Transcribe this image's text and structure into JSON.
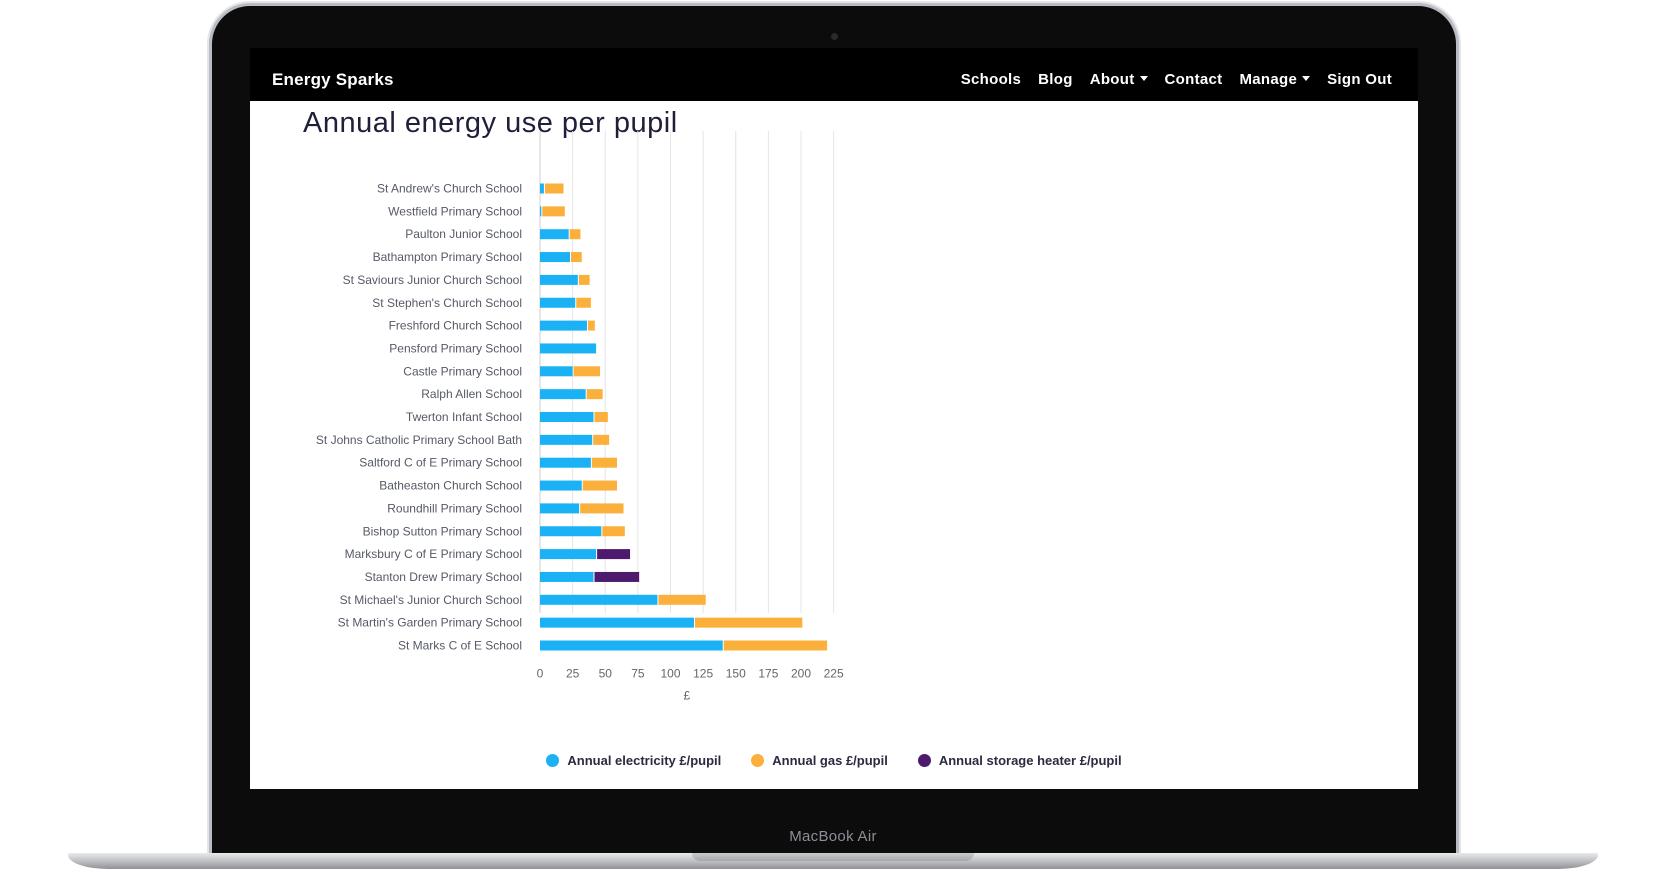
{
  "device_label": "MacBook Air",
  "navbar": {
    "brand": "Energy Sparks",
    "links": [
      "Schools",
      "Blog",
      "About",
      "Contact",
      "Manage",
      "Sign Out"
    ]
  },
  "page_title": "Annual energy use per pupil",
  "colors": {
    "electricity": "#1ab2f5",
    "gas": "#fbb03b",
    "storage_heater": "#4d1a6e",
    "gridline": "#e4e4e4"
  },
  "chart_data": {
    "type": "bar",
    "orientation": "horizontal",
    "stacked": true,
    "categories": [
      "St Andrew's Church School",
      "Westfield Primary School",
      "Paulton Junior School",
      "Bathampton Primary School",
      "St Saviours Junior Church School",
      "St Stephen's Church School",
      "Freshford Church School",
      "Pensford Primary School",
      "Castle Primary School",
      "Ralph Allen School",
      "Twerton Infant School",
      "St Johns Catholic Primary School Bath",
      "Saltford C of E Primary School",
      "Batheaston Church School",
      "Roundhill Primary School",
      "Bishop Sutton Primary School",
      "Marksbury C of E Primary School",
      "Stanton Drew Primary School",
      "St Michael's Junior Church School",
      "St Martin's Garden Primary School",
      "St Marks C of E School"
    ],
    "series": [
      {
        "name": "Annual electricity £/pupil",
        "values": [
          3,
          1,
          22,
          23,
          29,
          27,
          36,
          43,
          25,
          35,
          41,
          40,
          39,
          32,
          30,
          47,
          43,
          41,
          90,
          118,
          140
        ]
      },
      {
        "name": "Annual gas £/pupil",
        "values": [
          15,
          18,
          9,
          9,
          9,
          12,
          6,
          0,
          21,
          13,
          11,
          13,
          20,
          27,
          34,
          18,
          0,
          0,
          37,
          83,
          80
        ]
      },
      {
        "name": "Annual storage heater £/pupil",
        "values": [
          0,
          0,
          0,
          0,
          0,
          0,
          0,
          0,
          0,
          0,
          0,
          0,
          0,
          0,
          0,
          0,
          26,
          35,
          0,
          0,
          0
        ]
      }
    ],
    "x_ticks": [
      0,
      25,
      50,
      75,
      100,
      125,
      150,
      175,
      200,
      225
    ],
    "xlim": [
      0,
      225
    ],
    "xlabel": "£",
    "ylabel": "",
    "title": "Annual energy use per pupil",
    "grid": true,
    "legend_position": "bottom"
  }
}
